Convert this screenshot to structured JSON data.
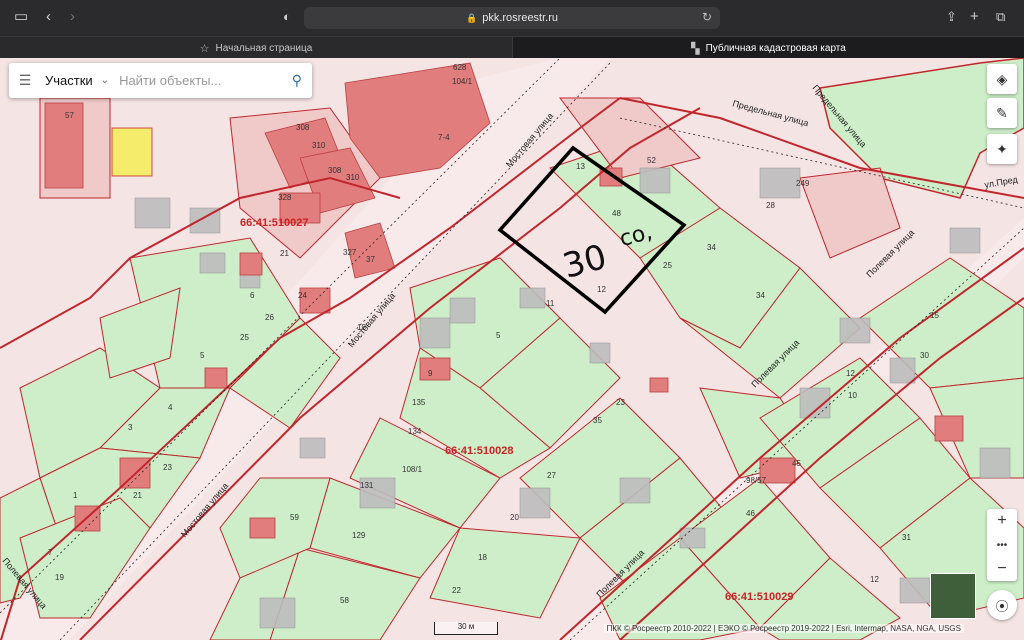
{
  "browser": {
    "url": "pkk.rosreestr.ru",
    "tabs": [
      {
        "label": "Начальная страница"
      },
      {
        "label": "Публичная кадастровая карта"
      }
    ]
  },
  "search": {
    "layer": "Участки",
    "placeholder": "Найти объекты..."
  },
  "map": {
    "quarters": [
      "66:41:510027",
      "66:41:510028",
      "66:41:510029"
    ],
    "streets": [
      "Мостовая улица",
      "Предельная улица",
      "Полевая улица",
      "ул.Пред"
    ],
    "parcel_numbers": [
      "57",
      "628",
      "104/1",
      "7-4",
      "308",
      "310",
      "308",
      "310",
      "328",
      "327",
      "37",
      "5",
      "21",
      "6",
      "24",
      "26",
      "18",
      "25",
      "5",
      "4",
      "3",
      "23",
      "21",
      "1",
      "7",
      "19",
      "135",
      "134",
      "108/1",
      "129",
      "131",
      "59",
      "58",
      "9",
      "11",
      "12",
      "13",
      "48",
      "52",
      "28",
      "34",
      "25",
      "34",
      "249",
      "27",
      "23",
      "35",
      "20",
      "18",
      "22",
      "46",
      "31",
      "10",
      "12",
      "98/57",
      "45",
      "15",
      "30",
      "12"
    ],
    "annotation_number": "30",
    "annotation_unit": "со,",
    "scale": "30 м",
    "attribution": "ПКК © Росреестр 2010-2022 | ЕЭКО © Росреестр 2019-2022 | Esri, Intermap, NASA, NGA, USGS"
  },
  "colors": {
    "parcel_green": "#cdeec9",
    "parcel_pink": "#f0c9c9",
    "building_red": "#e27d7d",
    "boundary_red": "#c0262c",
    "road": "#f6dede",
    "accent_blue": "#2a6fb0"
  }
}
